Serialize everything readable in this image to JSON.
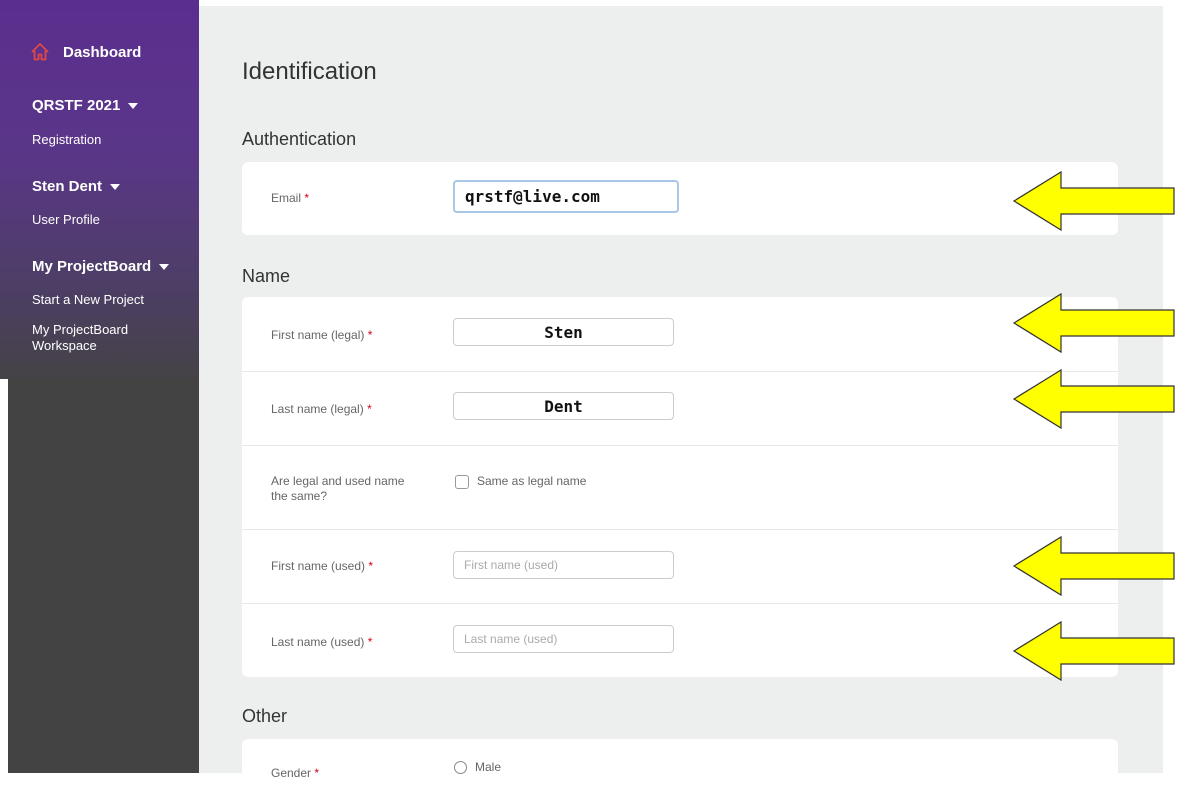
{
  "sidebar": {
    "dashboard_label": "Dashboard",
    "sections": [
      {
        "title": "QRSTF 2021",
        "items": [
          "Registration"
        ]
      },
      {
        "title": "Sten Dent",
        "items": [
          "User Profile"
        ]
      },
      {
        "title": "My ProjectBoard",
        "items": [
          "Start a New Project",
          "My ProjectBoard Workspace"
        ]
      }
    ]
  },
  "page": {
    "title": "Identification",
    "authentication": {
      "title": "Authentication",
      "email_label": "Email",
      "email_value": "qrstf@live.com"
    },
    "name": {
      "title": "Name",
      "first_legal_label": "First name (legal)",
      "first_legal_value": "Sten",
      "last_legal_label": "Last name (legal)",
      "last_legal_value": "Dent",
      "same_question_label": "Are legal and used name the same?",
      "same_checkbox_label": "Same as legal name",
      "first_used_label": "First name (used)",
      "first_used_placeholder": "First name (used)",
      "last_used_label": "Last name (used)",
      "last_used_placeholder": "Last name (used)"
    },
    "other": {
      "title": "Other",
      "gender_label": "Gender",
      "gender_option_male": "Male"
    },
    "required_marker": "*"
  },
  "colors": {
    "sidebar_top": "#5a2e8e",
    "sidebar_bottom": "#434343",
    "main_background": "#ecefee",
    "required": "#d0021b",
    "annotation_arrow": "#ffff00",
    "dashboard_icon": "#e04848"
  },
  "icons": {
    "dashboard": "home-icon",
    "section_toggle": "caret-down-icon",
    "annotation": "arrow-left-icon"
  }
}
